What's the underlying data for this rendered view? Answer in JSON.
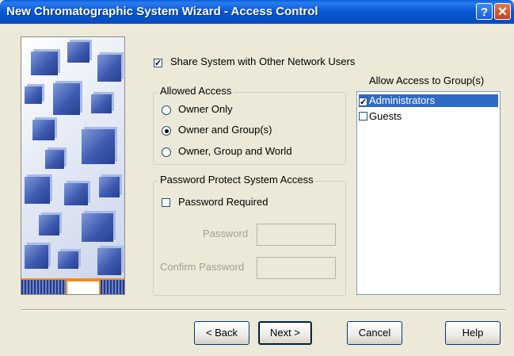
{
  "window": {
    "title": "New Chromatographic System Wizard - Access Control"
  },
  "titlebar": {
    "help_glyph": "?",
    "close_glyph": "✕"
  },
  "share": {
    "label": "Share System with Other Network Users",
    "checked": true
  },
  "allowed_access": {
    "legend": "Allowed Access",
    "options": [
      {
        "label": "Owner Only",
        "selected": false
      },
      {
        "label": "Owner and Group(s)",
        "selected": true
      },
      {
        "label": "Owner, Group and World",
        "selected": false
      }
    ]
  },
  "password": {
    "legend": "Password Protect System Access",
    "required_label": "Password Required",
    "required_checked": false,
    "password_label": "Password",
    "password_value": "",
    "confirm_label": "Confirm Password",
    "confirm_value": ""
  },
  "groups": {
    "heading": "Allow Access to Group(s)",
    "items": [
      {
        "label": "Administrators",
        "checked": true,
        "selected": true
      },
      {
        "label": "Guests",
        "checked": false,
        "selected": false
      }
    ]
  },
  "buttons": {
    "back": "< Back",
    "next": "Next >",
    "cancel": "Cancel",
    "help": "Help"
  },
  "icons": [
    "help-icon",
    "close-icon",
    "wizard-art"
  ],
  "colors": {
    "titlebar": "#0a5fd8",
    "selection": "#316ac5",
    "background": "#ece9d8"
  }
}
